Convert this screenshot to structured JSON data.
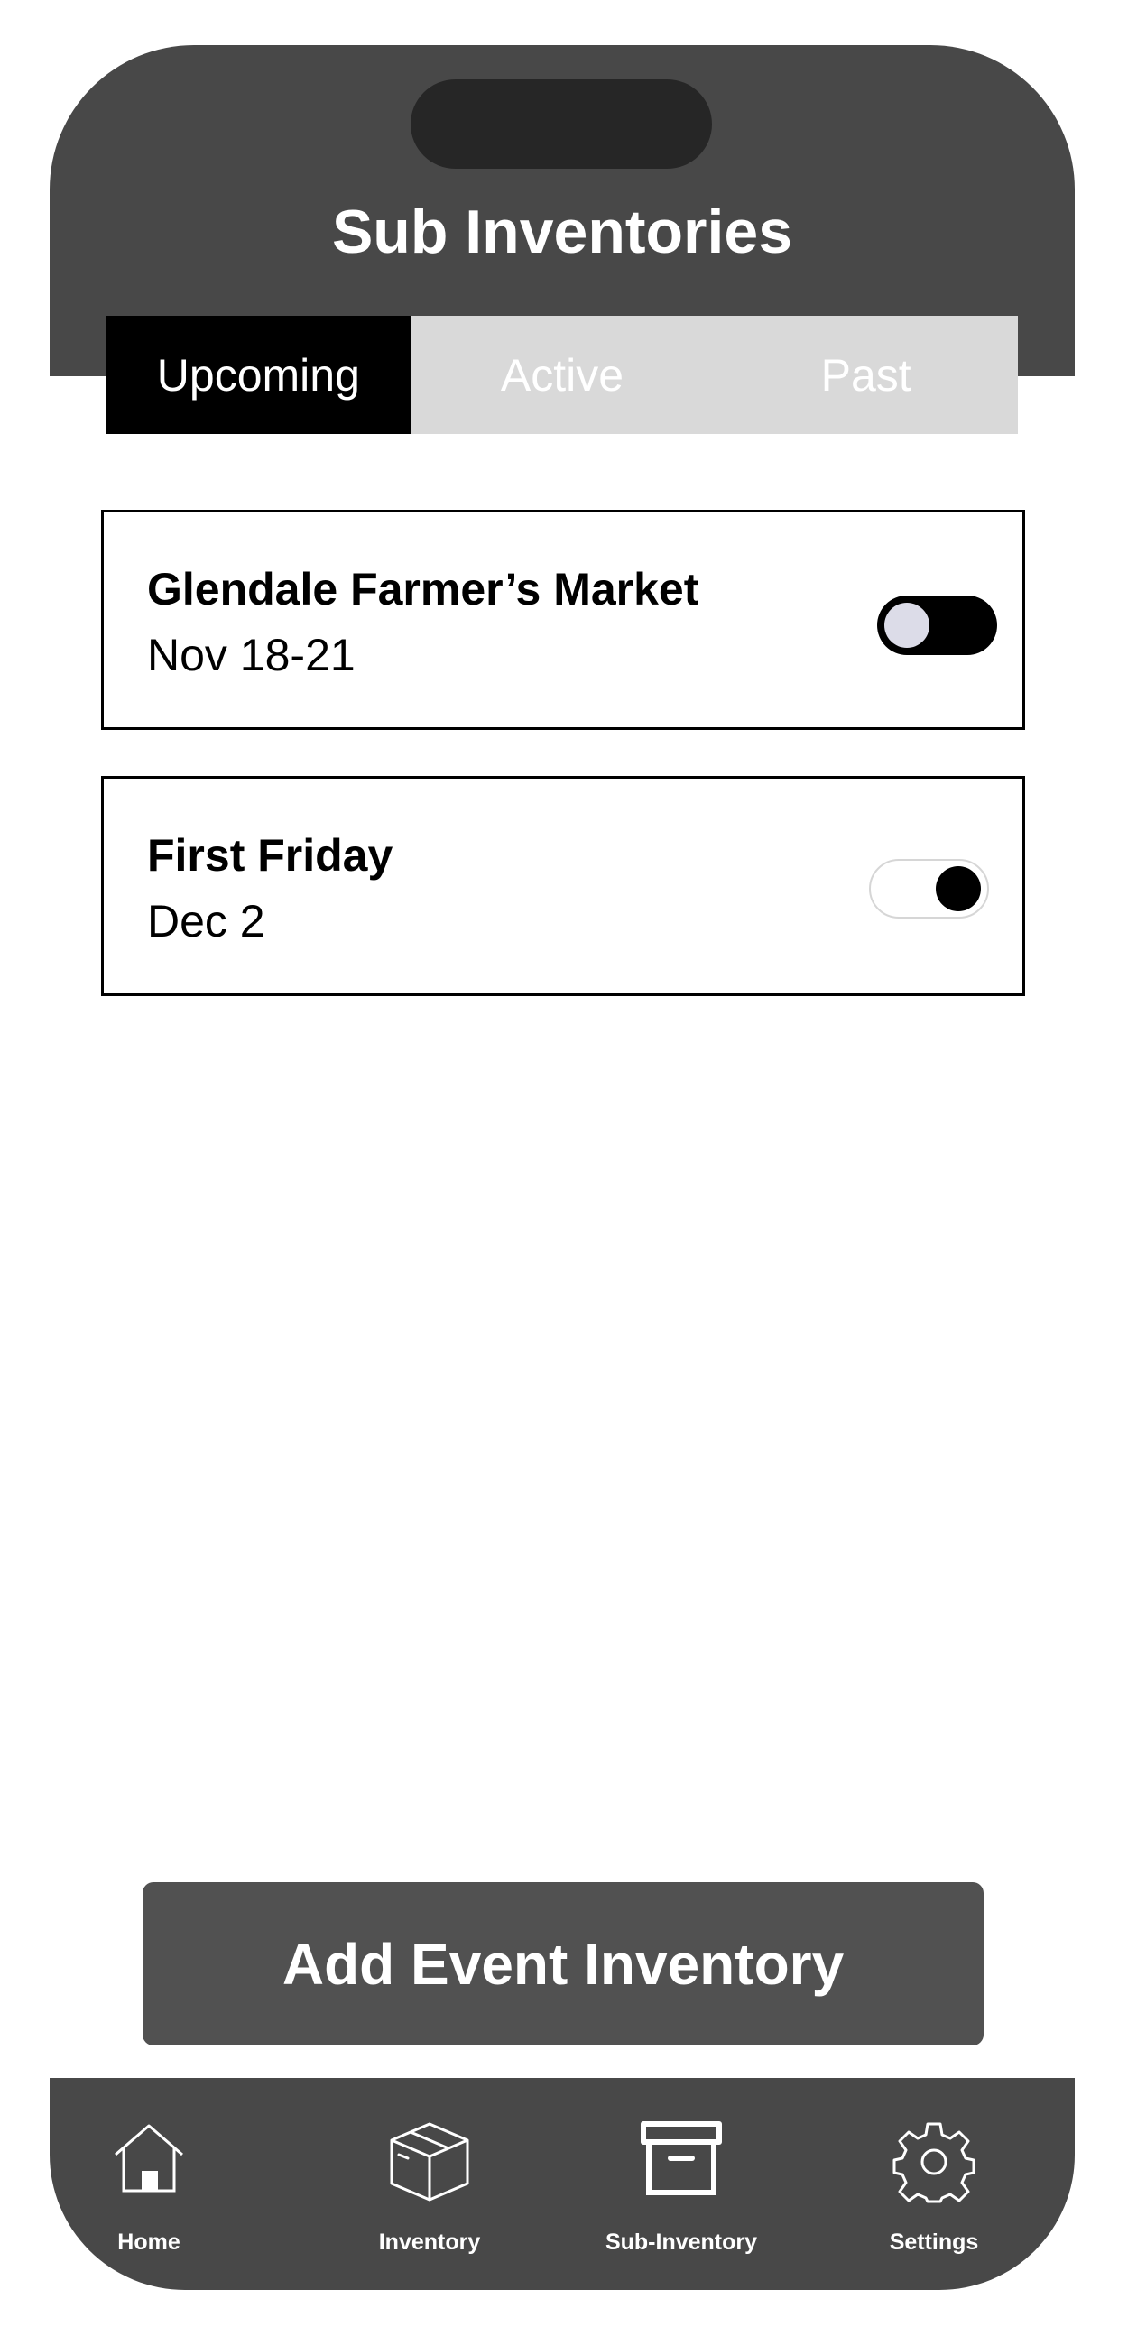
{
  "header": {
    "title": "Sub Inventories"
  },
  "tabs": [
    {
      "label": "Upcoming",
      "selected": true
    },
    {
      "label": "Active",
      "selected": false
    },
    {
      "label": "Past",
      "selected": false
    }
  ],
  "events": [
    {
      "name": "Glendale Farmer’s Market",
      "date": "Nov 18-21",
      "toggle_on": true
    },
    {
      "name": "First Friday",
      "date": "Dec 2",
      "toggle_on": false
    }
  ],
  "actions": {
    "add_event_label": "Add Event Inventory"
  },
  "bottom_nav": [
    {
      "label": "Home",
      "icon": "home-icon"
    },
    {
      "label": "Inventory",
      "icon": "box-icon"
    },
    {
      "label": "Sub-Inventory",
      "icon": "archive-icon"
    },
    {
      "label": "Settings",
      "icon": "gear-icon"
    }
  ],
  "colors": {
    "header_bg": "#484848",
    "tab_selected": "#000000",
    "tab_unselected": "#d9d9d9",
    "button_bg": "#515151"
  }
}
